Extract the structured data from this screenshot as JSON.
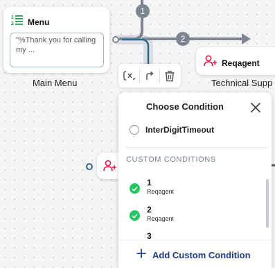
{
  "canvas": {
    "badges": [
      "1",
      "2"
    ]
  },
  "menu_node": {
    "title": "Menu",
    "preview_text": "\"%Thank you for calling my ...",
    "caption": "Main Menu",
    "icon": "numbered-list-icon"
  },
  "reqagent_node": {
    "title": "Reqagent",
    "caption": "Technical Supp",
    "icon": "add-user-icon"
  },
  "toolbar": {
    "icons": [
      "close-variable-icon",
      "redirect-arrow-icon",
      "trash-icon"
    ]
  },
  "panel": {
    "title": "Choose Condition",
    "option": "InterDigitTimeout",
    "section_header": "CUSTOM CONDITIONS",
    "conditions": [
      {
        "number": "1",
        "label": "Reqagent"
      },
      {
        "number": "2",
        "label": "Reqagent"
      },
      {
        "number": "3",
        "label": ""
      }
    ],
    "add_label": "Add Custom Condition"
  },
  "colors": {
    "accent_green": "#22c55e",
    "menu_icon_green": "#16a34a",
    "agent_icon_pink": "#e11d48",
    "add_text_navy": "#1e3a8a",
    "wire_gray": "#7c8590",
    "wire_highlight": "#2b6a8c"
  }
}
